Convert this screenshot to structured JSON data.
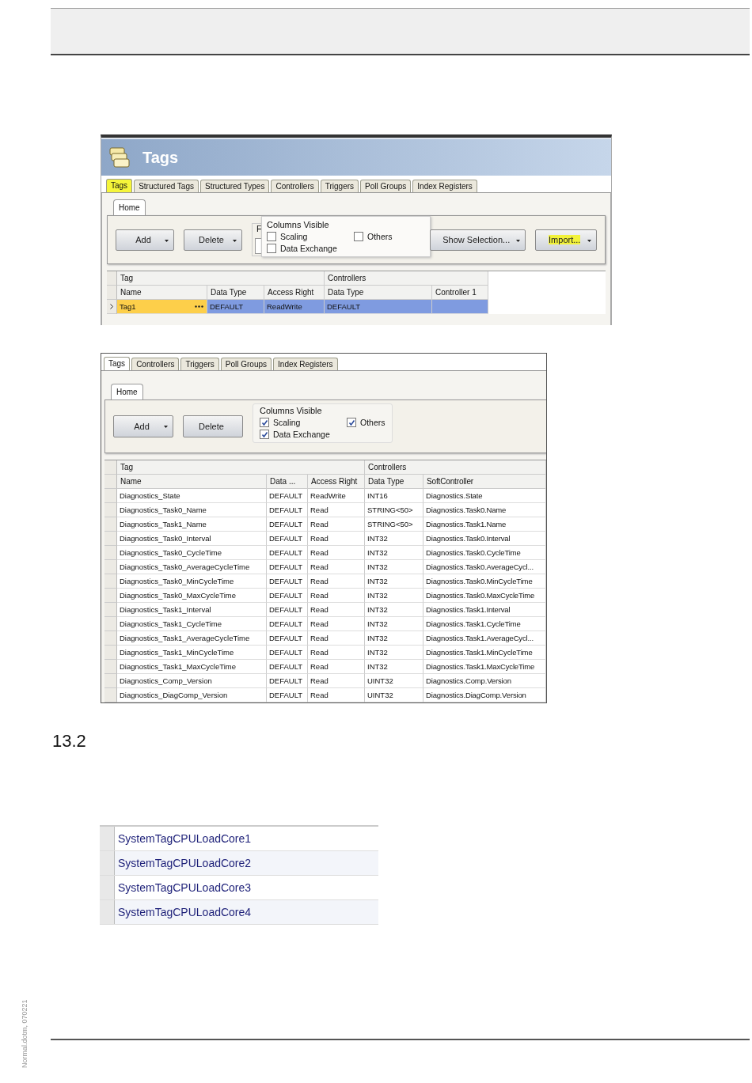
{
  "tag_editors": [
    {
      "title": "Tags",
      "tabs": [
        {
          "label": "Tags",
          "selected": true,
          "highlighted": true
        },
        {
          "label": "Structured Tags",
          "selected": false,
          "highlighted": false
        },
        {
          "label": "Structured Types",
          "selected": false,
          "highlighted": false
        },
        {
          "label": "Controllers",
          "selected": false,
          "highlighted": false
        },
        {
          "label": "Triggers",
          "selected": false,
          "highlighted": false
        },
        {
          "label": "Poll Groups",
          "selected": false,
          "highlighted": false
        },
        {
          "label": "Index Registers",
          "selected": false,
          "highlighted": false
        }
      ],
      "ribbon_tab": "Home",
      "ribbon_items": [
        {
          "kind": "button",
          "label": "Add",
          "dropdown": true,
          "highlighted": false
        },
        {
          "kind": "button",
          "label": "Delete",
          "dropdown": true,
          "highlighted": false
        },
        {
          "kind": "group",
          "label": "F",
          "popup": {
            "title": "Columns Visible",
            "options": [
              {
                "label": "Scaling",
                "checked": false
              },
              {
                "label": "Others",
                "checked": false
              },
              {
                "label": "Data Exchange",
                "checked": false
              }
            ]
          }
        },
        {
          "kind": "button",
          "label": "Show Selection...",
          "dropdown": true,
          "highlighted": false
        },
        {
          "kind": "button",
          "label": "Import...",
          "dropdown": true,
          "highlighted": true
        }
      ],
      "table": {
        "group_headers": [
          "Tag",
          "Controllers"
        ],
        "columns": [
          "Name",
          "Data Type",
          "Access Right",
          "Data Type",
          "Controller 1"
        ],
        "rows": [
          {
            "cells": [
              "Tag1",
              "DEFAULT",
              "ReadWrite",
              "DEFAULT",
              ""
            ],
            "selected": true,
            "editing": true
          }
        ]
      }
    },
    {
      "tabs": [
        {
          "label": "Tags",
          "selected": true,
          "highlighted": false
        },
        {
          "label": "Controllers",
          "selected": false,
          "highlighted": false
        },
        {
          "label": "Triggers",
          "selected": false,
          "highlighted": false
        },
        {
          "label": "Poll Groups",
          "selected": false,
          "highlighted": false
        },
        {
          "label": "Index Registers",
          "selected": false,
          "highlighted": false
        }
      ],
      "ribbon_tab": "Home",
      "ribbon_items": [
        {
          "kind": "button",
          "label": "Add",
          "dropdown": true,
          "highlighted": false
        },
        {
          "kind": "button",
          "label": "Delete",
          "dropdown": false,
          "highlighted": false
        },
        {
          "kind": "checkbox_group",
          "title": "Columns Visible",
          "options": [
            {
              "label": "Scaling",
              "checked": true
            },
            {
              "label": "Others",
              "checked": true
            },
            {
              "label": "Data Exchange",
              "checked": true
            }
          ]
        }
      ],
      "table": {
        "group_headers": [
          "Tag",
          "Controllers"
        ],
        "columns": [
          "Name",
          "Data ...",
          "Access Right",
          "Data Type",
          "SoftController"
        ],
        "rows": [
          {
            "cells": [
              "Diagnostics_State",
              "DEFAULT",
              "ReadWrite",
              "INT16",
              "Diagnostics.State"
            ],
            "selected": false,
            "editing": false
          },
          {
            "cells": [
              "Diagnostics_Task0_Name",
              "DEFAULT",
              "Read",
              "STRING<50>",
              "Diagnostics.Task0.Name"
            ],
            "selected": false,
            "editing": false
          },
          {
            "cells": [
              "Diagnostics_Task1_Name",
              "DEFAULT",
              "Read",
              "STRING<50>",
              "Diagnostics.Task1.Name"
            ],
            "selected": false,
            "editing": false
          },
          {
            "cells": [
              "Diagnostics_Task0_Interval",
              "DEFAULT",
              "Read",
              "INT32",
              "Diagnostics.Task0.Interval"
            ],
            "selected": false,
            "editing": false
          },
          {
            "cells": [
              "Diagnostics_Task0_CycleTime",
              "DEFAULT",
              "Read",
              "INT32",
              "Diagnostics.Task0.CycleTime"
            ],
            "selected": false,
            "editing": false
          },
          {
            "cells": [
              "Diagnostics_Task0_AverageCycleTime",
              "DEFAULT",
              "Read",
              "INT32",
              "Diagnostics.Task0.AverageCycl..."
            ],
            "selected": false,
            "editing": false
          },
          {
            "cells": [
              "Diagnostics_Task0_MinCycleTime",
              "DEFAULT",
              "Read",
              "INT32",
              "Diagnostics.Task0.MinCycleTime"
            ],
            "selected": false,
            "editing": false
          },
          {
            "cells": [
              "Diagnostics_Task0_MaxCycleTime",
              "DEFAULT",
              "Read",
              "INT32",
              "Diagnostics.Task0.MaxCycleTime"
            ],
            "selected": false,
            "editing": false
          },
          {
            "cells": [
              "Diagnostics_Task1_Interval",
              "DEFAULT",
              "Read",
              "INT32",
              "Diagnostics.Task1.Interval"
            ],
            "selected": false,
            "editing": false
          },
          {
            "cells": [
              "Diagnostics_Task1_CycleTime",
              "DEFAULT",
              "Read",
              "INT32",
              "Diagnostics.Task1.CycleTime"
            ],
            "selected": false,
            "editing": false
          },
          {
            "cells": [
              "Diagnostics_Task1_AverageCycleTime",
              "DEFAULT",
              "Read",
              "INT32",
              "Diagnostics.Task1.AverageCycl..."
            ],
            "selected": false,
            "editing": false
          },
          {
            "cells": [
              "Diagnostics_Task1_MinCycleTime",
              "DEFAULT",
              "Read",
              "INT32",
              "Diagnostics.Task1.MinCycleTime"
            ],
            "selected": false,
            "editing": false
          },
          {
            "cells": [
              "Diagnostics_Task1_MaxCycleTime",
              "DEFAULT",
              "Read",
              "INT32",
              "Diagnostics.Task1.MaxCycleTime"
            ],
            "selected": false,
            "editing": false
          },
          {
            "cells": [
              "Diagnostics_Comp_Version",
              "DEFAULT",
              "Read",
              "UINT32",
              "Diagnostics.Comp.Version"
            ],
            "selected": false,
            "editing": false
          },
          {
            "cells": [
              "Diagnostics_DiagComp_Version",
              "DEFAULT",
              "Read",
              "UINT32",
              "Diagnostics.DiagComp.Version"
            ],
            "selected": false,
            "editing": false
          }
        ]
      }
    }
  ],
  "section": {
    "number": "13.2"
  },
  "system_tag_list": {
    "rows": [
      "SystemTagCPULoadCore1",
      "SystemTagCPULoadCore2",
      "SystemTagCPULoadCore3",
      "SystemTagCPULoadCore4"
    ]
  },
  "margin_note": "Normal.dotm, 070221"
}
